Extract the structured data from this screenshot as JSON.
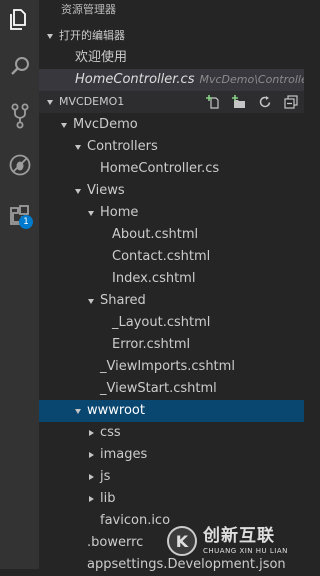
{
  "sidebar": {
    "title": "资源管理器"
  },
  "activity_bar": {
    "items": [
      {
        "icon": "files-icon"
      },
      {
        "icon": "search-icon"
      },
      {
        "icon": "source-control-icon"
      },
      {
        "icon": "debug-icon"
      },
      {
        "icon": "extensions-icon",
        "badge": "1"
      }
    ]
  },
  "open_editors": {
    "header": "打开的编辑器",
    "items": [
      {
        "name": "欢迎使用",
        "path": ""
      },
      {
        "name": "HomeController.cs",
        "path": "MvcDemo\\Controllers"
      }
    ]
  },
  "project": {
    "header": "MVCDEMO1",
    "toolbar": [
      "new-file-icon",
      "new-folder-icon",
      "refresh-icon",
      "collapse-all-icon"
    ]
  },
  "tree": [
    {
      "label": "MvcDemo",
      "expanded": true
    },
    {
      "label": "Controllers",
      "expanded": true
    },
    {
      "label": "HomeController.cs"
    },
    {
      "label": "Views",
      "expanded": true
    },
    {
      "label": "Home",
      "expanded": true
    },
    {
      "label": "About.cshtml"
    },
    {
      "label": "Contact.cshtml"
    },
    {
      "label": "Index.cshtml"
    },
    {
      "label": "Shared",
      "expanded": true
    },
    {
      "label": "_Layout.cshtml"
    },
    {
      "label": "Error.cshtml"
    },
    {
      "label": "_ViewImports.cshtml"
    },
    {
      "label": "_ViewStart.cshtml"
    },
    {
      "label": "wwwroot",
      "expanded": true,
      "selected": true
    },
    {
      "label": "css",
      "expanded": false
    },
    {
      "label": "images",
      "expanded": false
    },
    {
      "label": "js",
      "expanded": false
    },
    {
      "label": "lib",
      "expanded": false
    },
    {
      "label": "favicon.ico"
    },
    {
      "label": ".bowerrc"
    },
    {
      "label": "appsettings.Development.json"
    }
  ],
  "watermark": {
    "logo_mark": "K",
    "name": "创新互联",
    "subtitle": "CHUANG XIN HU LIAN"
  },
  "colors": {
    "activity_bar": "#333333",
    "sidebar": "#252526",
    "selection": "#094771",
    "badge": "#007acc",
    "text": "#cccccc"
  }
}
